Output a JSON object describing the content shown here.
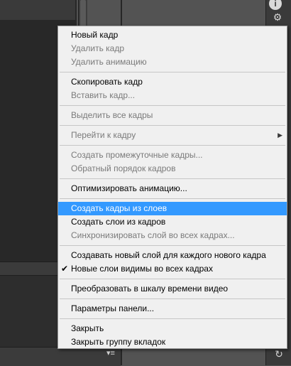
{
  "dock": {
    "info_glyph": "i",
    "gear_glyph": "⚙",
    "history_glyph": "↻"
  },
  "panel_menu_glyph": "▾≡",
  "menu": {
    "items": [
      {
        "label": "Новый кадр",
        "enabled": true
      },
      {
        "label": "Удалить кадр",
        "enabled": false
      },
      {
        "label": "Удалить анимацию",
        "enabled": false
      },
      {
        "label": "Скопировать кадр",
        "enabled": true
      },
      {
        "label": "Вставить кадр...",
        "enabled": false
      },
      {
        "label": "Выделить все кадры",
        "enabled": false
      },
      {
        "label": "Перейти к кадру",
        "enabled": false,
        "submenu": true
      },
      {
        "label": "Создать промежуточные кадры...",
        "enabled": false
      },
      {
        "label": "Обратный порядок кадров",
        "enabled": false
      },
      {
        "label": "Оптимизировать анимацию...",
        "enabled": true
      },
      {
        "label": "Создать кадры из слоев",
        "enabled": true,
        "highlighted": true
      },
      {
        "label": "Создать слои из кадров",
        "enabled": true
      },
      {
        "label": "Синхронизировать слой во всех кадрах...",
        "enabled": false
      },
      {
        "label": "Создавать новый слой для каждого нового кадра",
        "enabled": true
      },
      {
        "label": "Новые слои видимы во всех кадрах",
        "enabled": true,
        "checked": true
      },
      {
        "label": "Преобразовать в шкалу времени видео",
        "enabled": true
      },
      {
        "label": "Параметры панели...",
        "enabled": true
      },
      {
        "label": "Закрыть",
        "enabled": true
      },
      {
        "label": "Закрыть группу вкладок",
        "enabled": true
      }
    ],
    "check_glyph": "✔",
    "submenu_glyph": "▶",
    "highlight_color": "#3399ff"
  }
}
